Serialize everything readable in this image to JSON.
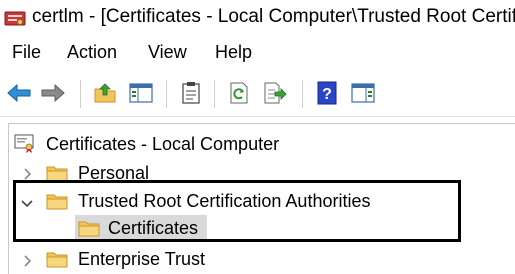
{
  "window": {
    "title": "certlm - [Certificates - Local Computer\\Trusted Root Certifi"
  },
  "menu": {
    "file": "File",
    "action": "Action",
    "view": "View",
    "help": "Help"
  },
  "toolbar": {
    "buttons": [
      "back-arrow-icon",
      "forward-arrow-icon",
      "up-folder-icon",
      "show-hide-tree-icon",
      "properties-clipboard-icon",
      "refresh-icon",
      "export-list-icon",
      "help-icon",
      "action-pane-icon"
    ]
  },
  "tree": {
    "root": "Certificates - Local Computer",
    "personal": "Personal",
    "trusted_root": "Trusted Root Certification Authorities",
    "trusted_root_child": "Certificates",
    "enterprise": "Enterprise Trust"
  },
  "colors": {
    "folder": "#f2c55c",
    "folder_edge": "#c9972a",
    "selection": "#d9d9d9",
    "arrow_blue": "#2f8fd8"
  }
}
